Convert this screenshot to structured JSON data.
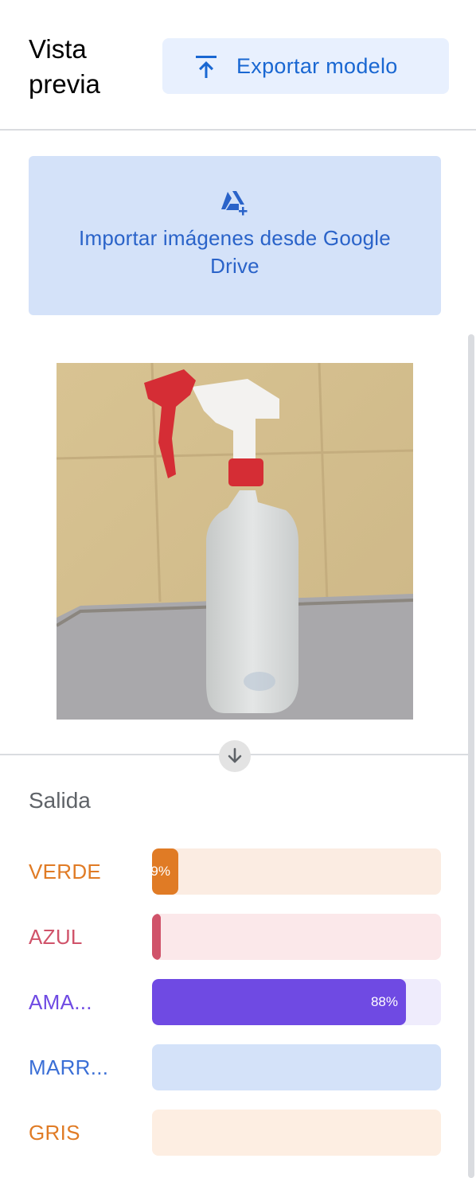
{
  "header": {
    "title": "Vista previa",
    "export_label": "Exportar modelo"
  },
  "import": {
    "label": "Importar imágenes desde Google Drive"
  },
  "preview": {
    "description_icon": "image-preview"
  },
  "output": {
    "title": "Salida",
    "classes": [
      {
        "label": "VERDE",
        "percent": 9,
        "value_text": "9%",
        "color": "#e07b25",
        "track_color": "#fbece2"
      },
      {
        "label": "AZUL",
        "percent": 3,
        "value_text": "",
        "color": "#d0536a",
        "track_color": "#fbe8ea"
      },
      {
        "label": "AMA...",
        "percent": 88,
        "value_text": "88%",
        "color": "#6f4ae3",
        "track_color": "#efecfc"
      },
      {
        "label": "MARR...",
        "percent": 0,
        "value_text": "",
        "color": "#3b6fd6",
        "track_color": "#d4e2f9"
      },
      {
        "label": "GRIS",
        "percent": 0,
        "value_text": "",
        "color": "#e07b25",
        "track_color": "#fdeee2"
      }
    ]
  },
  "colors": {
    "accent": "#1967d2",
    "button_bg": "#e8f0fe",
    "import_bg": "#d4e2f9"
  }
}
